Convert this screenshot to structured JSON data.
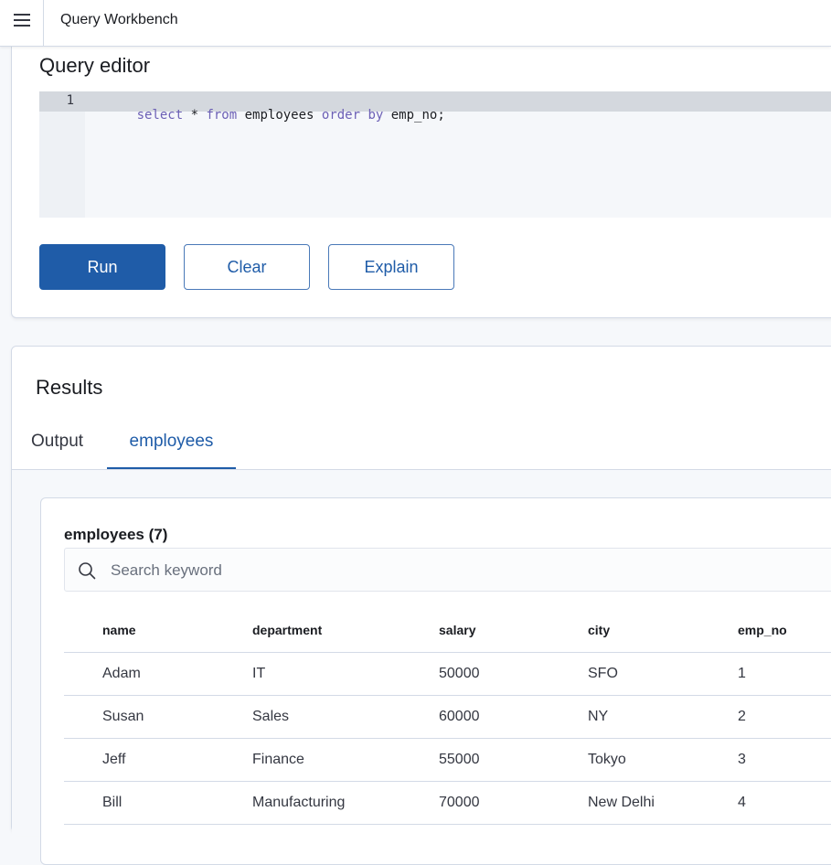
{
  "topbar": {
    "menu_icon": "hamburger-menu-icon",
    "title": "Query Workbench"
  },
  "editor": {
    "heading": "Query editor",
    "line_number": "1",
    "query_tokens": [
      {
        "text": "select",
        "type": "keyword"
      },
      {
        "text": " * ",
        "type": "plain"
      },
      {
        "text": "from",
        "type": "keyword"
      },
      {
        "text": " employees ",
        "type": "plain"
      },
      {
        "text": "order by",
        "type": "keyword"
      },
      {
        "text": " emp_no;",
        "type": "plain"
      }
    ],
    "buttons": {
      "run": "Run",
      "clear": "Clear",
      "explain": "Explain"
    }
  },
  "results": {
    "heading": "Results",
    "tabs": [
      {
        "label": "Output",
        "active": false
      },
      {
        "label": "employees",
        "active": true
      }
    ],
    "table_title": "employees (7)",
    "search": {
      "placeholder": "Search keyword",
      "value": "",
      "icon": "search-icon"
    },
    "columns": [
      "name",
      "department",
      "salary",
      "city",
      "emp_no"
    ],
    "rows": [
      [
        "Adam",
        "IT",
        "50000",
        "SFO",
        "1"
      ],
      [
        "Susan",
        "Sales",
        "60000",
        "NY",
        "2"
      ],
      [
        "Jeff",
        "Finance",
        "55000",
        "Tokyo",
        "3"
      ],
      [
        "Bill",
        "Manufacturing",
        "70000",
        "New Delhi",
        "4"
      ]
    ]
  },
  "colors": {
    "accent": "#1f5ca8",
    "keyword": "#6b5fb5",
    "active_line": "#d4d8de",
    "border": "#d3dae6"
  }
}
